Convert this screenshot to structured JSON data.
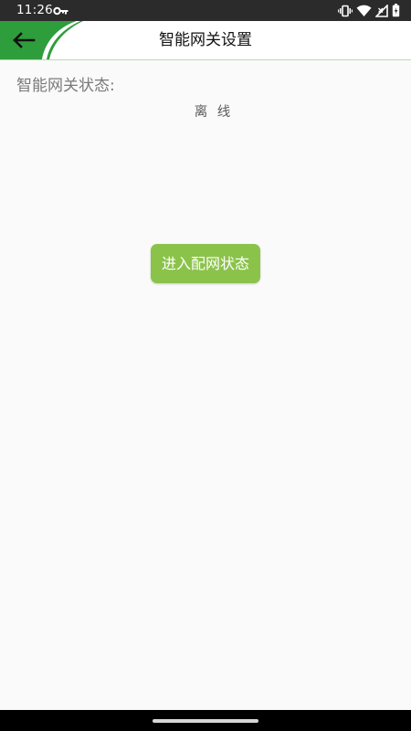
{
  "status_bar": {
    "time": "11:26",
    "icons": [
      "key-icon",
      "vibrate-icon",
      "wifi-icon",
      "signal-icon",
      "battery-icon"
    ]
  },
  "app_bar": {
    "title": "智能网关设置",
    "back_icon": "arrow-left-icon",
    "accent_color": "#2e9d3c"
  },
  "gateway": {
    "status_label": "智能网关状态:",
    "status_value": "离 线"
  },
  "actions": {
    "enter_config_label": "进入配网状态",
    "button_color": "#8bc34a"
  }
}
